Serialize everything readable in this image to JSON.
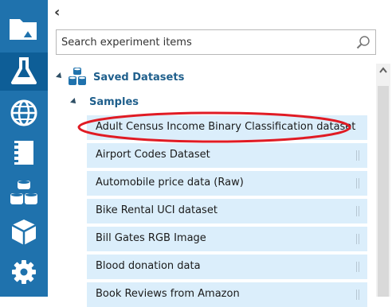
{
  "nav": {
    "items": [
      {
        "name": "projects-icon"
      },
      {
        "name": "experiments-icon"
      },
      {
        "name": "web-services-icon"
      },
      {
        "name": "notebooks-icon"
      },
      {
        "name": "datasets-icon"
      },
      {
        "name": "trained-models-icon"
      },
      {
        "name": "settings-icon"
      }
    ],
    "active": "experiments-icon",
    "color": "#1f72ad",
    "active_color": "#0e5e97"
  },
  "panel": {
    "collapse_glyph": "‹",
    "search": {
      "placeholder": "Search experiment items",
      "value": ""
    },
    "tree": {
      "root_label": "Saved Datasets",
      "group_label": "Samples",
      "items": [
        "Adult Census Income Binary Classification dataset",
        "Airport Codes Dataset",
        "Automobile price data (Raw)",
        "Bike Rental UCI dataset",
        "Bill Gates RGB Image",
        "Blood donation data",
        "Book Reviews from Amazon"
      ],
      "highlighted_item": "Adult Census Income Binary Classification dataset"
    }
  },
  "colors": {
    "item_bg": "#dbeefb",
    "label_blue": "#1f5f8c",
    "highlight_red": "#e01b24"
  }
}
